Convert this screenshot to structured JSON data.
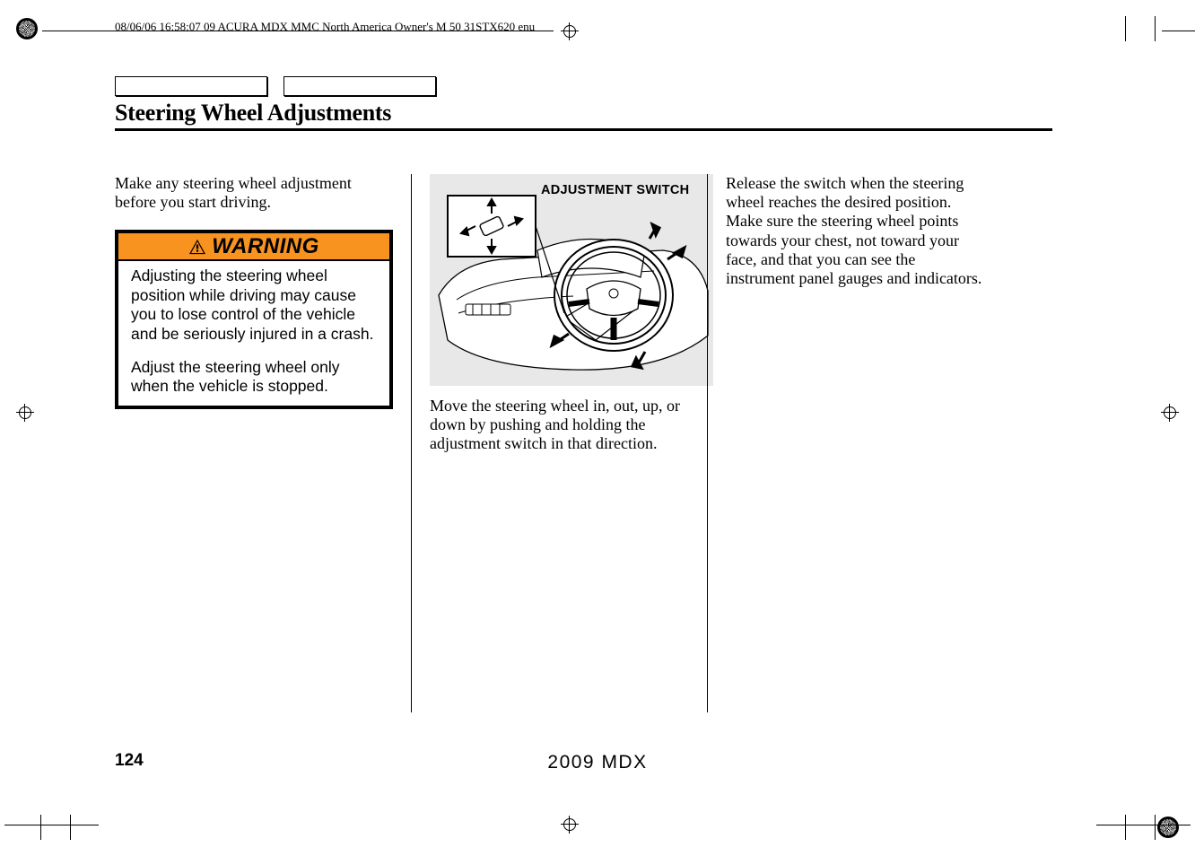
{
  "header_meta": "08/06/06 16:58:07    09 ACURA MDX MMC North America Owner's M 50 31STX620 enu",
  "heading": "Steering Wheel Adjustments",
  "col1": {
    "intro": "Make any steering wheel adjustment before you start driving.",
    "warning_label": "WARNING",
    "warning_p1": "Adjusting the steering wheel position while driving may cause you to lose control of the vehicle and be seriously injured in a crash.",
    "warning_p2": "Adjust the steering wheel only when the vehicle is stopped."
  },
  "col2": {
    "diagram_label": "ADJUSTMENT SWITCH",
    "text": "Move the steering wheel in, out, up, or down by pushing and holding the adjustment switch in that direction."
  },
  "col3": {
    "text": "Release the switch when the steering wheel reaches the desired position. Make sure the steering wheel points towards your chest, not toward your face, and that you can see the instrument panel gauges and indicators."
  },
  "page_number": "124",
  "footer_model": "2009  MDX"
}
